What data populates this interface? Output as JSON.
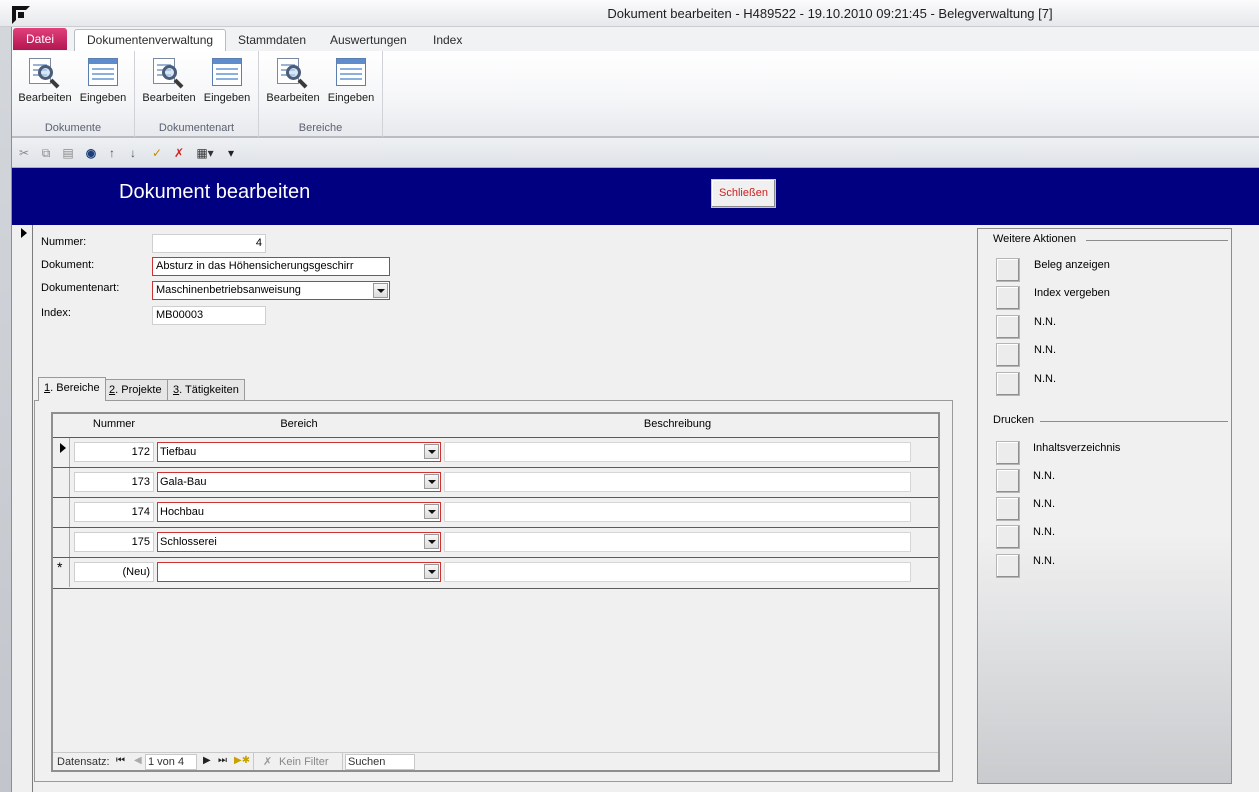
{
  "window": {
    "title": "Dokument bearbeiten  -  H489522 - 19.10.2010 09:21:45  -  Belegverwaltung [7]"
  },
  "ribbon": {
    "tabs": [
      "Datei",
      "Dokumentenverwaltung",
      "Stammdaten",
      "Auswertungen",
      "Index"
    ],
    "active_tab": "Dokumentenverwaltung",
    "groups": [
      {
        "label": "Dokumente",
        "buttons": [
          "Bearbeiten",
          "Eingeben"
        ]
      },
      {
        "label": "Dokumentenart",
        "buttons": [
          "Bearbeiten",
          "Eingeben"
        ]
      },
      {
        "label": "Bereiche",
        "buttons": [
          "Bearbeiten",
          "Eingeben"
        ]
      }
    ]
  },
  "quick_toolbar": {
    "icons": [
      "cut-icon",
      "copy-icon",
      "paste-icon",
      "find-icon",
      "sort-ascending-icon",
      "sort-descending-icon",
      "filter-icon",
      "clear-filter-icon",
      "view-switch-icon",
      "customize-icon"
    ]
  },
  "form": {
    "title": "Dokument bearbeiten",
    "close_label": "Schließen",
    "fields": {
      "nummer": {
        "label": "Nummer:",
        "value": "4"
      },
      "dokument": {
        "label": "Dokument:",
        "value": "Absturz in das Höhensicherungsgeschirr"
      },
      "dokumentenart": {
        "label": "Dokumentenart:",
        "value": "Maschinenbetriebsanweisung"
      },
      "index": {
        "label": "Index:",
        "value": "MB00003"
      }
    }
  },
  "subform": {
    "tabs": [
      {
        "key": "1",
        "rest": ". Bereiche"
      },
      {
        "key": "2",
        "rest": ". Projekte"
      },
      {
        "key": "3",
        "rest": ". Tätigkeiten"
      }
    ],
    "active_tab": 0,
    "columns": [
      "Nummer",
      "Bereich",
      "Beschreibung"
    ],
    "rows": [
      {
        "nummer": "172",
        "bereich": "Tiefbau",
        "beschreibung": ""
      },
      {
        "nummer": "173",
        "bereich": "Gala-Bau",
        "beschreibung": ""
      },
      {
        "nummer": "174",
        "bereich": "Hochbau",
        "beschreibung": ""
      },
      {
        "nummer": "175",
        "bereich": "Schlosserei",
        "beschreibung": ""
      },
      {
        "nummer": "(Neu)",
        "bereich": "",
        "beschreibung": ""
      }
    ],
    "new_row_marker": "*",
    "navigation": {
      "label": "Datensatz:",
      "position": "1 von 4",
      "filter_label": "Kein Filter",
      "search_label": "Suchen"
    }
  },
  "actions_panel": {
    "weitere_title": "Weitere Aktionen",
    "weitere": [
      "Beleg anzeigen",
      "Index vergeben",
      "N.N.",
      "N.N.",
      "N.N."
    ],
    "drucken_title": "Drucken",
    "drucken": [
      "Inhaltsverzeichnis",
      "N.N.",
      "N.N.",
      "N.N.",
      "N.N."
    ]
  },
  "colors": {
    "header_band": "#000080",
    "datei_tab": "#c21a5a",
    "required_border": "#cc3333",
    "close_text": "#cc1f1f"
  }
}
